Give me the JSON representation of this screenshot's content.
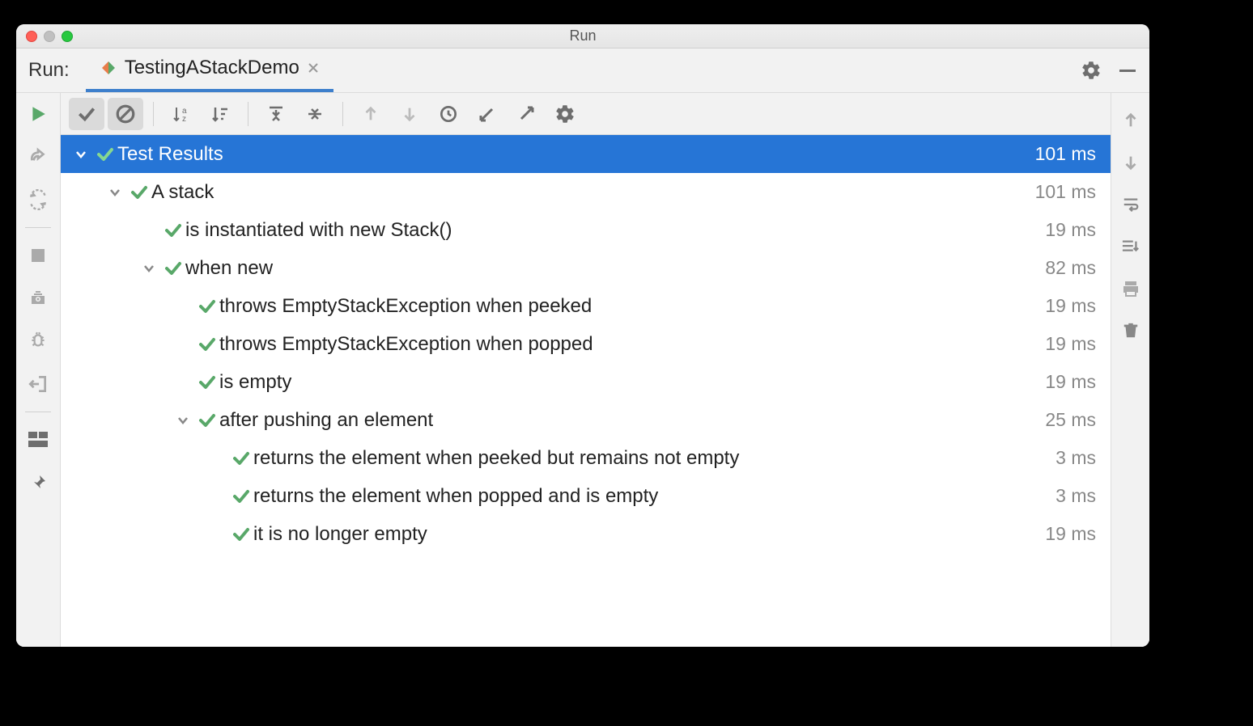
{
  "window": {
    "title": "Run"
  },
  "tabbar": {
    "run_label": "Run:",
    "tab_name": "TestingAStackDemo"
  },
  "tree": [
    {
      "depth": 0,
      "expandable": true,
      "label": "Test Results",
      "time": "101 ms",
      "selected": true
    },
    {
      "depth": 1,
      "expandable": true,
      "label": "A stack",
      "time": "101 ms"
    },
    {
      "depth": 2,
      "expandable": false,
      "label": "is instantiated with new Stack()",
      "time": "19 ms"
    },
    {
      "depth": 2,
      "expandable": true,
      "label": "when new",
      "time": "82 ms"
    },
    {
      "depth": 3,
      "expandable": false,
      "label": "throws EmptyStackException when peeked",
      "time": "19 ms"
    },
    {
      "depth": 3,
      "expandable": false,
      "label": "throws EmptyStackException when popped",
      "time": "19 ms"
    },
    {
      "depth": 3,
      "expandable": false,
      "label": "is empty",
      "time": "19 ms"
    },
    {
      "depth": 3,
      "expandable": true,
      "label": "after pushing an element",
      "time": "25 ms"
    },
    {
      "depth": 4,
      "expandable": false,
      "label": "returns the element when peeked but remains not empty",
      "time": "3 ms"
    },
    {
      "depth": 4,
      "expandable": false,
      "label": "returns the element when popped and is empty",
      "time": "3 ms"
    },
    {
      "depth": 4,
      "expandable": false,
      "label": "it is no longer empty",
      "time": "19 ms"
    }
  ]
}
